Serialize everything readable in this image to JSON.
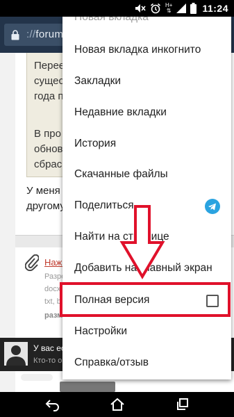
{
  "status_bar": {
    "time": "11:24",
    "network": "H+",
    "icons": [
      "mute-icon",
      "alarm-icon",
      "signal-icon",
      "battery-icon"
    ]
  },
  "url_bar": {
    "scheme_text": "://",
    "host_text": "forum"
  },
  "page": {
    "quote_lines": [
      "Перее",
      "сущес",
      "года п",
      "",
      "В про",
      "обнов",
      "сбрас"
    ],
    "post_lines": [
      "У меня п",
      "другому"
    ],
    "attachment_link": "Нажм",
    "attachment_meta": [
      "Разре",
      "docx",
      "txt, b",
      "разм"
    ]
  },
  "snackbar": {
    "title": "У вас ес",
    "subtitle": "Кто-то о"
  },
  "menu": {
    "items": [
      {
        "label": "Новая вкладка"
      },
      {
        "label": "Новая вкладка инкогнито"
      },
      {
        "label": "Закладки"
      },
      {
        "label": "Недавние вкладки"
      },
      {
        "label": "История"
      },
      {
        "label": "Скачанные файлы"
      },
      {
        "label": "Поделиться..."
      },
      {
        "label": "Найти на странице"
      },
      {
        "label": "Добавить на главный экран"
      },
      {
        "label": "Полная версия",
        "checked": false
      },
      {
        "label": "Настройки"
      },
      {
        "label": "Справка/отзыв"
      }
    ]
  },
  "colors": {
    "highlight": "#e0112b",
    "url_bar": "#23344a",
    "telegram": "#2aa3e0"
  }
}
